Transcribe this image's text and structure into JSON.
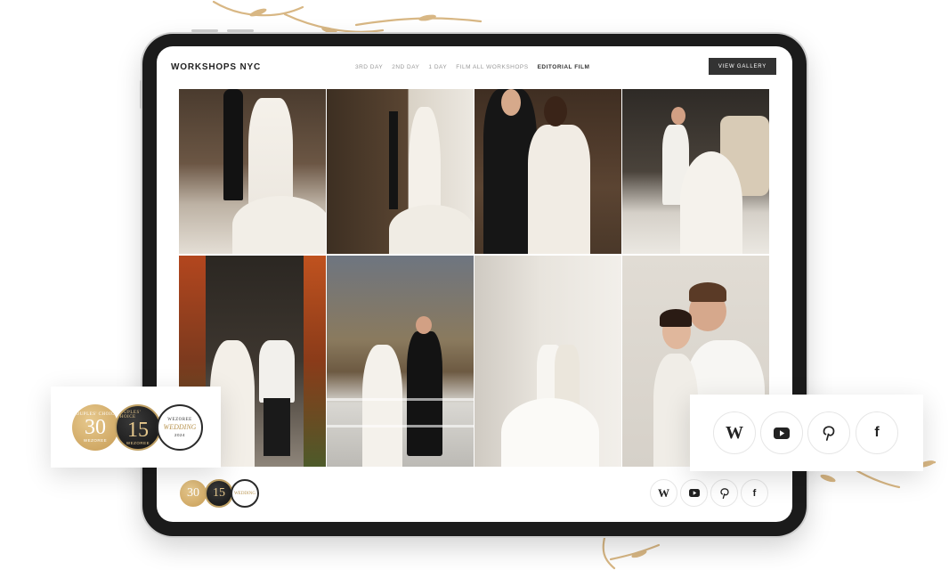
{
  "site": {
    "logo": "WORKSHOPS NYC",
    "nav": [
      {
        "label": "3RD DAY",
        "active": false
      },
      {
        "label": "2ND DAY",
        "active": false
      },
      {
        "label": "1 DAY",
        "active": false
      },
      {
        "label": "FILM ALL WORKSHOPS",
        "active": false
      },
      {
        "label": "EDITORIAL FILM",
        "active": true
      }
    ],
    "cta_label": "VIEW GALLERY"
  },
  "badges": [
    {
      "number": "30",
      "top": "COUPLES' CHOICE",
      "bottom": "WEZOREE",
      "style": "gold"
    },
    {
      "number": "15",
      "top": "COUPLES' CHOICE",
      "bottom": "WEZOREE",
      "style": "dark"
    },
    {
      "number": "WEDDING",
      "top": "WEZOREE",
      "bottom": "2024",
      "style": "light"
    }
  ],
  "socials": [
    {
      "name": "wezoree",
      "glyph": "W"
    },
    {
      "name": "youtube",
      "glyph": "▶"
    },
    {
      "name": "pinterest",
      "glyph": "P"
    },
    {
      "name": "facebook",
      "glyph": "f"
    }
  ],
  "colors": {
    "accent_gold": "#d8b784",
    "tablet_frame": "#1b1b1b",
    "button_dark": "#333333"
  },
  "photos": [
    {
      "name": "photo-couple-doorway"
    },
    {
      "name": "photo-bride-wooden-door"
    },
    {
      "name": "photo-couple-kiss-doorway"
    },
    {
      "name": "photo-couple-vintage-car"
    },
    {
      "name": "photo-couple-flower-arch"
    },
    {
      "name": "photo-couple-street-night"
    },
    {
      "name": "photo-couple-marble-wall"
    },
    {
      "name": "photo-couple-closeup"
    }
  ]
}
